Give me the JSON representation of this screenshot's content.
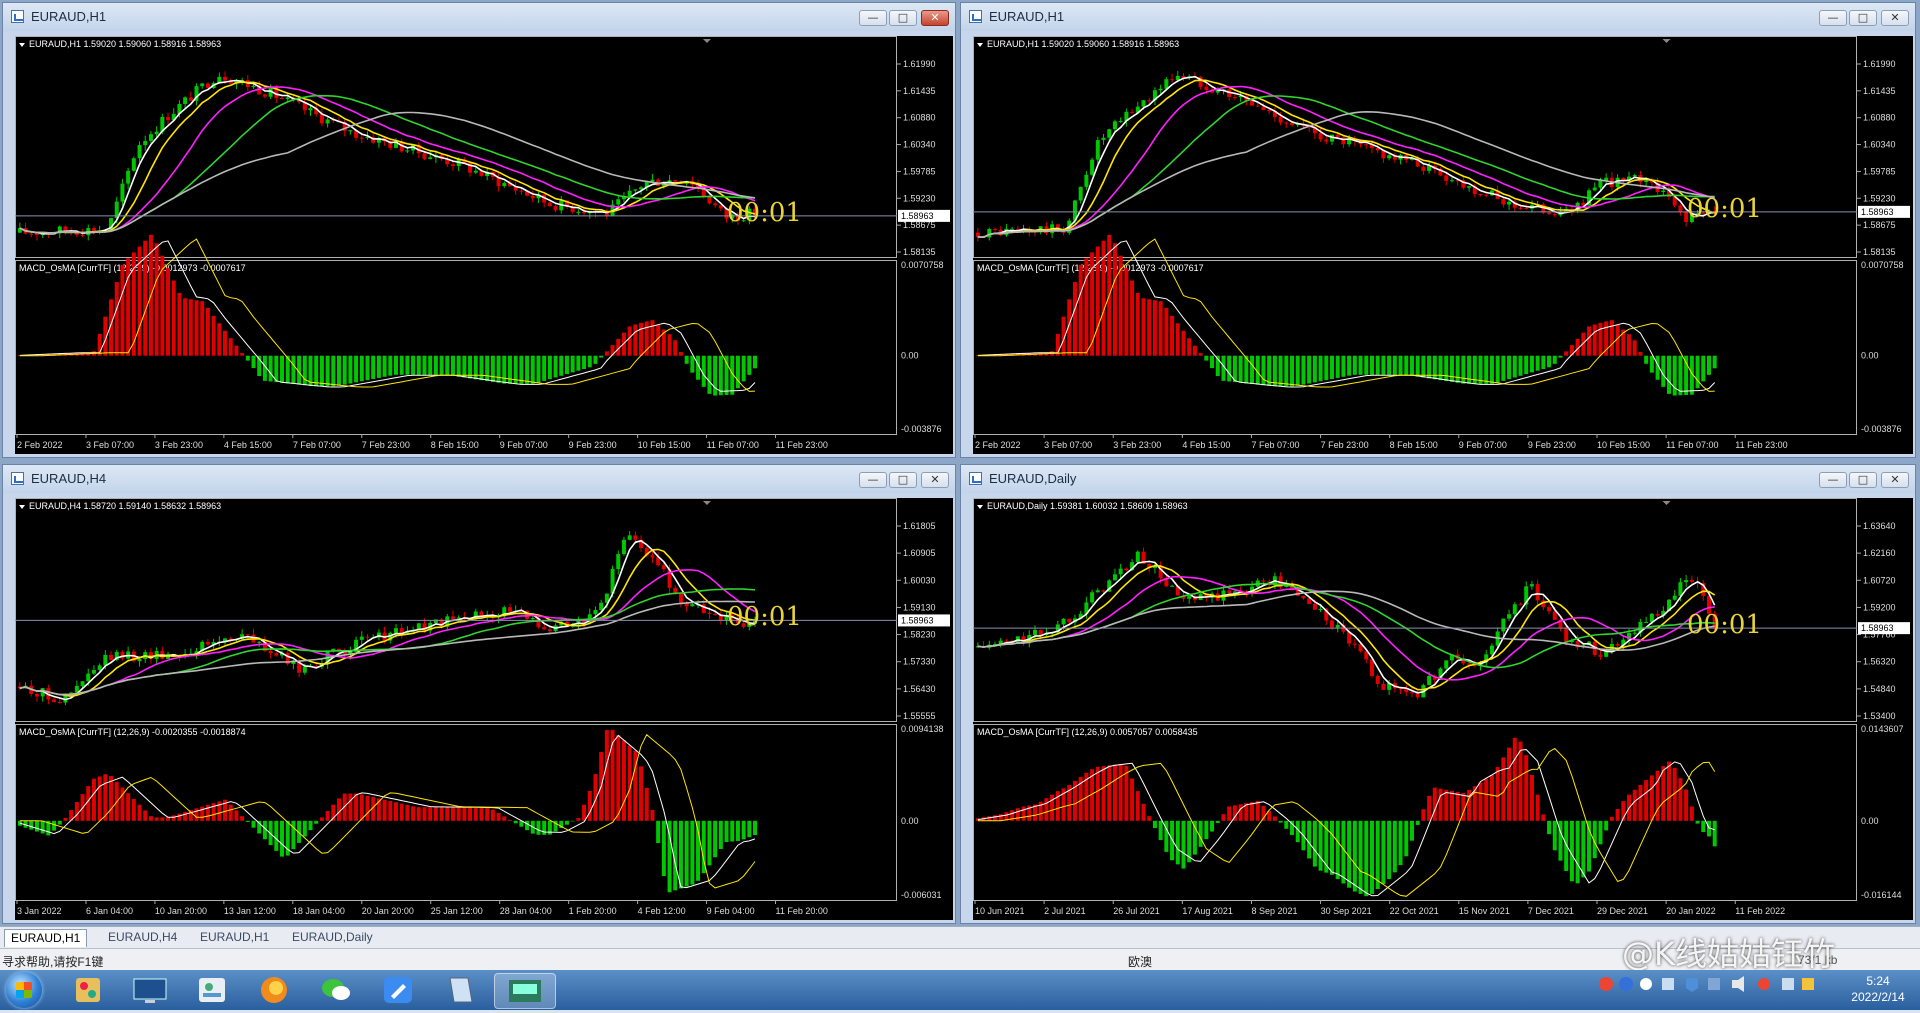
{
  "windows": [
    {
      "title": "EURAUD,H1",
      "info": "EURAUD,H1  1.59020 1.59060 1.58916 1.58963",
      "macd": "MACD_OsMA [CurrTF] (12,26,9) -0.0012973 -0.0007617",
      "price_ticks": [
        "1.61990",
        "1.61435",
        "1.60880",
        "1.60340",
        "1.59785",
        "1.59230",
        "1.58675",
        "1.58135"
      ],
      "price_current": "1.58963",
      "macd_ticks": [
        "0.0070758",
        "0.00",
        "-0.003876"
      ],
      "time_ticks": [
        "2 Feb 2022",
        "3 Feb 07:00",
        "3 Feb 23:00",
        "4 Feb 15:00",
        "7 Feb 07:00",
        "7 Feb 23:00",
        "8 Feb 15:00",
        "9 Feb 07:00",
        "9 Feb 23:00",
        "10 Feb 15:00",
        "11 Feb 07:00",
        "11 Feb 23:00"
      ],
      "clock": "00:01",
      "close_active": true
    },
    {
      "title": "EURAUD,H1",
      "info": "EURAUD,H1  1.59020 1.59060 1.58916 1.58963",
      "macd": "MACD_OsMA [CurrTF] (12,26,9) -0.0012973 -0.0007617",
      "price_ticks": [
        "1.61990",
        "1.61435",
        "1.60880",
        "1.60340",
        "1.59785",
        "1.59230",
        "1.58675",
        "1.58135"
      ],
      "price_current": "1.58963",
      "macd_ticks": [
        "0.0070758",
        "0.00",
        "-0.003876"
      ],
      "time_ticks": [
        "2 Feb 2022",
        "3 Feb 07:00",
        "3 Feb 23:00",
        "4 Feb 15:00",
        "7 Feb 07:00",
        "7 Feb 23:00",
        "8 Feb 15:00",
        "9 Feb 07:00",
        "9 Feb 23:00",
        "10 Feb 15:00",
        "11 Feb 07:00",
        "11 Feb 23:00"
      ],
      "clock": "00:01",
      "close_active": false
    },
    {
      "title": "EURAUD,H4",
      "info": "EURAUD,H4  1.58720 1.59140 1.58632 1.58963",
      "macd": "MACD_OsMA [CurrTF] (12,26,9) -0.0020355 -0.0018874",
      "price_ticks": [
        "1.61805",
        "1.60905",
        "1.60030",
        "1.59130",
        "1.58230",
        "1.57330",
        "1.56430",
        "1.55555"
      ],
      "price_current": "1.58963",
      "macd_ticks": [
        "0.0094138",
        "0.00",
        "-0.006031"
      ],
      "time_ticks": [
        "3 Jan 2022",
        "6 Jan 04:00",
        "10 Jan 20:00",
        "13 Jan 12:00",
        "18 Jan 04:00",
        "20 Jan 20:00",
        "25 Jan 12:00",
        "28 Jan 04:00",
        "1 Feb 20:00",
        "4 Feb 12:00",
        "9 Feb 04:00",
        "11 Feb 20:00"
      ],
      "clock": "00:01",
      "close_active": false
    },
    {
      "title": "EURAUD,Daily",
      "info": "EURAUD,Daily  1.59381 1.60032 1.58609 1.58963",
      "macd": "MACD_OsMA [CurrTF] (12,26,9) 0.0057057 0.0058435",
      "price_ticks": [
        "1.63640",
        "1.62160",
        "1.60720",
        "1.59200",
        "1.57760",
        "1.56320",
        "1.54840",
        "1.53400"
      ],
      "price_current": "1.58963",
      "macd_ticks": [
        "0.0143607",
        "0.00",
        "-0.016144"
      ],
      "time_ticks": [
        "10 Jun 2021",
        "2 Jul 2021",
        "26 Jul 2021",
        "17 Aug 2021",
        "8 Sep 2021",
        "30 Sep 2021",
        "22 Oct 2021",
        "15 Nov 2021",
        "7 Dec 2021",
        "29 Dec 2021",
        "20 Jan 2022",
        "11 Feb 2022"
      ],
      "clock": "00:01",
      "close_active": false
    }
  ],
  "tabs": [
    "EURAUD,H1",
    "EURAUD,H4",
    "EURAUD,H1",
    "EURAUD,Daily"
  ],
  "status": {
    "help": "寻求帮助,请按F1键",
    "profile": "欧澳",
    "counter": "73/1 kb"
  },
  "watermark": "@K线姑姑钰竹",
  "tray": {
    "time": "5:24",
    "date": "2022/2/14"
  },
  "colors": {
    "bull": "#00c800",
    "bear": "#e00000",
    "ma_white": "#ffffff",
    "ma_yellow": "#ffe600",
    "ma_magenta": "#ff1fff",
    "ma_green": "#2fd42f",
    "ma_gray": "#b8b8b8",
    "clock": "#e8d534"
  },
  "icons": {
    "taskbar": [
      "start-orb",
      "paint-icon",
      "monitor-icon",
      "contacts-icon",
      "firefox-icon",
      "wechat-icon",
      "edit-icon",
      "document-icon",
      "mt4-icon"
    ]
  }
}
